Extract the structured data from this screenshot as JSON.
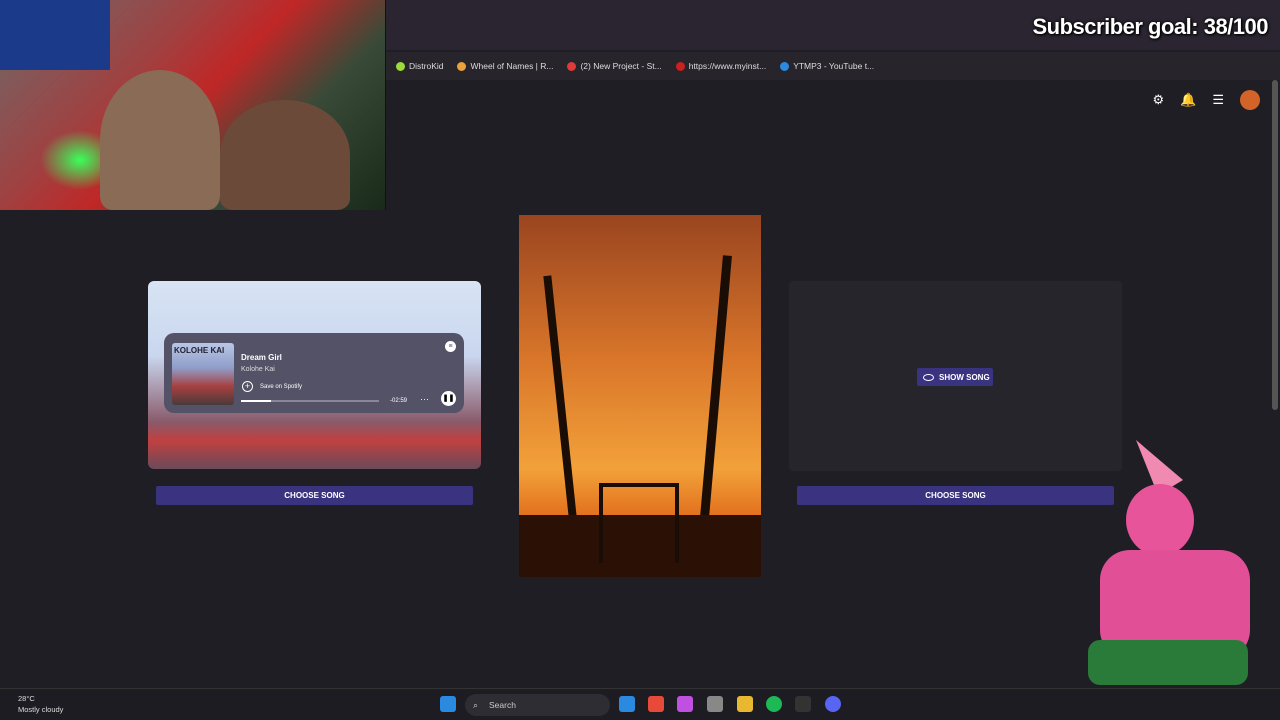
{
  "overlay": {
    "subscriber_goal": "Subscriber goal: 38/100"
  },
  "bookmarks": [
    {
      "label": "DistroKid",
      "color": "#9bdb3a"
    },
    {
      "label": "Wheel of Names | R...",
      "color": "#e9a23b"
    },
    {
      "label": "(2) New Project - St...",
      "color": "#e03b3b"
    },
    {
      "label": "https://www.myinst...",
      "color": "#cc2020"
    },
    {
      "label": "YTMP3 - YouTube t...",
      "color": "#2a8ae0"
    }
  ],
  "header_icons": [
    "gear-icon",
    "bell-icon",
    "menu-icon",
    "avatar"
  ],
  "spotify": {
    "album_text": "KOLOHE KAI",
    "song": "Dream Girl",
    "artist": "Kolohe Kai",
    "save_label": "Save on Spotify",
    "time_remaining": "-02:59",
    "progress": 0.22
  },
  "buttons": {
    "choose_song": "CHOOSE SONG",
    "show_song": "SHOW SONG"
  },
  "taskbar": {
    "temp": "28°C",
    "weather": "Mostly cloudy",
    "search_placeholder": "Search"
  }
}
